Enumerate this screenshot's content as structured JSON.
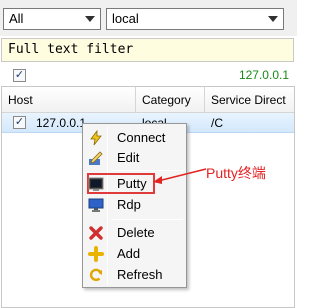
{
  "toolbar": {
    "group_select": "All",
    "location_select": "local"
  },
  "filter": {
    "placeholder": "Full text filter"
  },
  "status": {
    "checked": true,
    "ip": "127.0.0.1"
  },
  "grid": {
    "columns": [
      "Host",
      "Category",
      "Service Direct"
    ],
    "rows": [
      {
        "checked": true,
        "host": "127.0.0.1",
        "category": "local",
        "service_dir": "/C"
      }
    ]
  },
  "context_menu": {
    "items": [
      {
        "label": "Connect",
        "icon": "lightning-icon"
      },
      {
        "label": "Edit",
        "icon": "edit-icon"
      },
      {
        "label": "Putty",
        "icon": "terminal-icon",
        "highlighted": true
      },
      {
        "label": "Rdp",
        "icon": "remote-desktop-icon"
      },
      {
        "label": "Delete",
        "icon": "delete-x-icon"
      },
      {
        "label": "Add",
        "icon": "plus-icon"
      },
      {
        "label": "Refresh",
        "icon": "refresh-icon"
      }
    ]
  },
  "annotation": {
    "text": "Putty终端",
    "color": "#e22323"
  }
}
